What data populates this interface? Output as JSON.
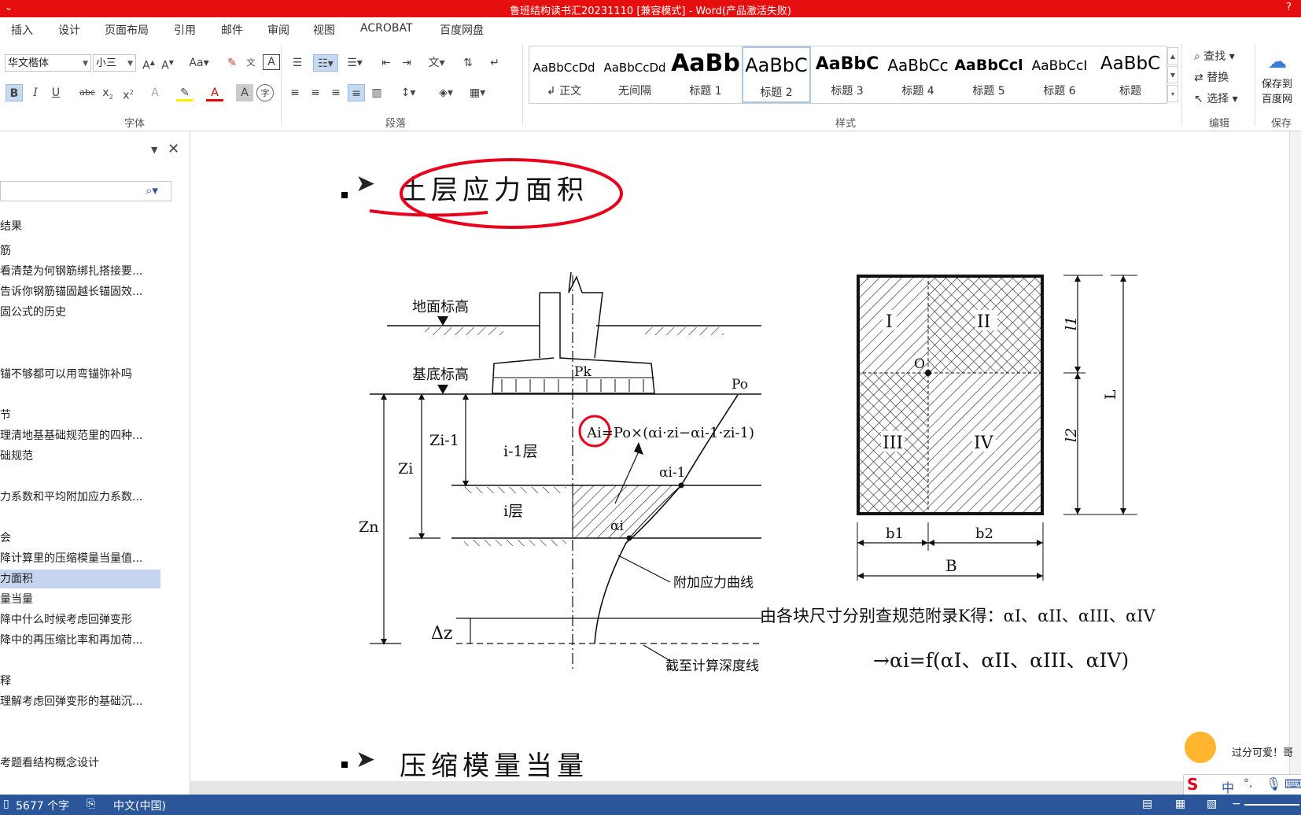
{
  "window": {
    "title": "鲁班结构读书汇20231110 [兼容模式] - Word(产品激活失败)",
    "help": "?"
  },
  "menu": {
    "tabs": [
      "插入",
      "设计",
      "页面布局",
      "引用",
      "邮件",
      "审阅",
      "视图",
      "ACROBAT",
      "百度网盘"
    ]
  },
  "font_group": {
    "font_name": "华文楷体",
    "font_size": "小三",
    "label": "字体"
  },
  "paragraph_group": {
    "label": "段落"
  },
  "styles_group": {
    "label": "样式",
    "items": [
      {
        "preview": "AaBbCcDd",
        "name": "↲ 正文"
      },
      {
        "preview": "AaBbCcDd",
        "name": "无间隔"
      },
      {
        "preview": "AaBb",
        "name": "标题 1"
      },
      {
        "preview": "AaBbC",
        "name": "标题 2"
      },
      {
        "preview": "AaBbC",
        "name": "标题 3"
      },
      {
        "preview": "AaBbCc",
        "name": "标题 4"
      },
      {
        "preview": "AaBbCcl",
        "name": "标题 5"
      },
      {
        "preview": "AaBbCcI",
        "name": "标题 6"
      },
      {
        "preview": "AaBbC",
        "name": "标题"
      }
    ]
  },
  "editing_group": {
    "find": "查找",
    "replace": "替换",
    "select": "选择",
    "label": "编辑"
  },
  "save_group": {
    "line1": "保存到",
    "line2": "百度网",
    "label": "保存"
  },
  "nav_pane": {
    "items": [
      "结果",
      "筋",
      "看清楚为何钢筋绑扎搭接要...",
      "告诉你钢筋锚固越长锚固效...",
      "固公式的历史",
      "锚不够都可以用弯锚弥补吗",
      "节",
      "理清地基基础规范里的四种...",
      "础规范",
      "力系数和平均附加应力系数...",
      "会",
      "降计算里的压缩模量当量值...",
      "力面积",
      "量当量",
      "降中什么时候考虑回弹变形",
      "降中的再压缩比率和再加荷...",
      "释",
      "理解考虑回弹变形的基础沉...",
      "考题看结构概念设计"
    ]
  },
  "document": {
    "heading1": "土层应力面积",
    "heading2": "压缩模量当量",
    "figure": {
      "ground_level": "地面标高",
      "base_level": "基底标高",
      "pk": "Pk",
      "p0": "Po",
      "formula": "Ai=Po×(αi·zi−αi-1·zi-1)",
      "zi_1": "Zi-1",
      "zi": "Zi",
      "zn": "Zn",
      "layer_i1": "i-1层",
      "layer_i": "i层",
      "alpha_i1": "αi-1",
      "alpha_i": "αi",
      "curve_label": "附加应力曲线",
      "dz": "Δz",
      "depth_line": "截至计算深度线"
    },
    "plan": {
      "r1": "I",
      "r2": "II",
      "r3": "III",
      "r4": "IV",
      "o": "O",
      "l1": "l1",
      "l2": "l2",
      "L": "L",
      "b1": "b1",
      "b2": "b2",
      "B": "B"
    },
    "note1": "由各块尺寸分别查规范附录K得：αI、αII、αIII、αIV",
    "note2": "→αi=f(αI、αII、αIII、αIV)"
  },
  "ime": {
    "bubble": "过分可爱！哥",
    "lang": "中"
  },
  "status": {
    "words": "5677 个字",
    "language": "中文(中国)"
  },
  "colors": {
    "title_bar": "#e60f0f",
    "status_bar": "#2b579a",
    "nav_selected": "#c5d5f0",
    "annotation_red": "#e8001c"
  }
}
